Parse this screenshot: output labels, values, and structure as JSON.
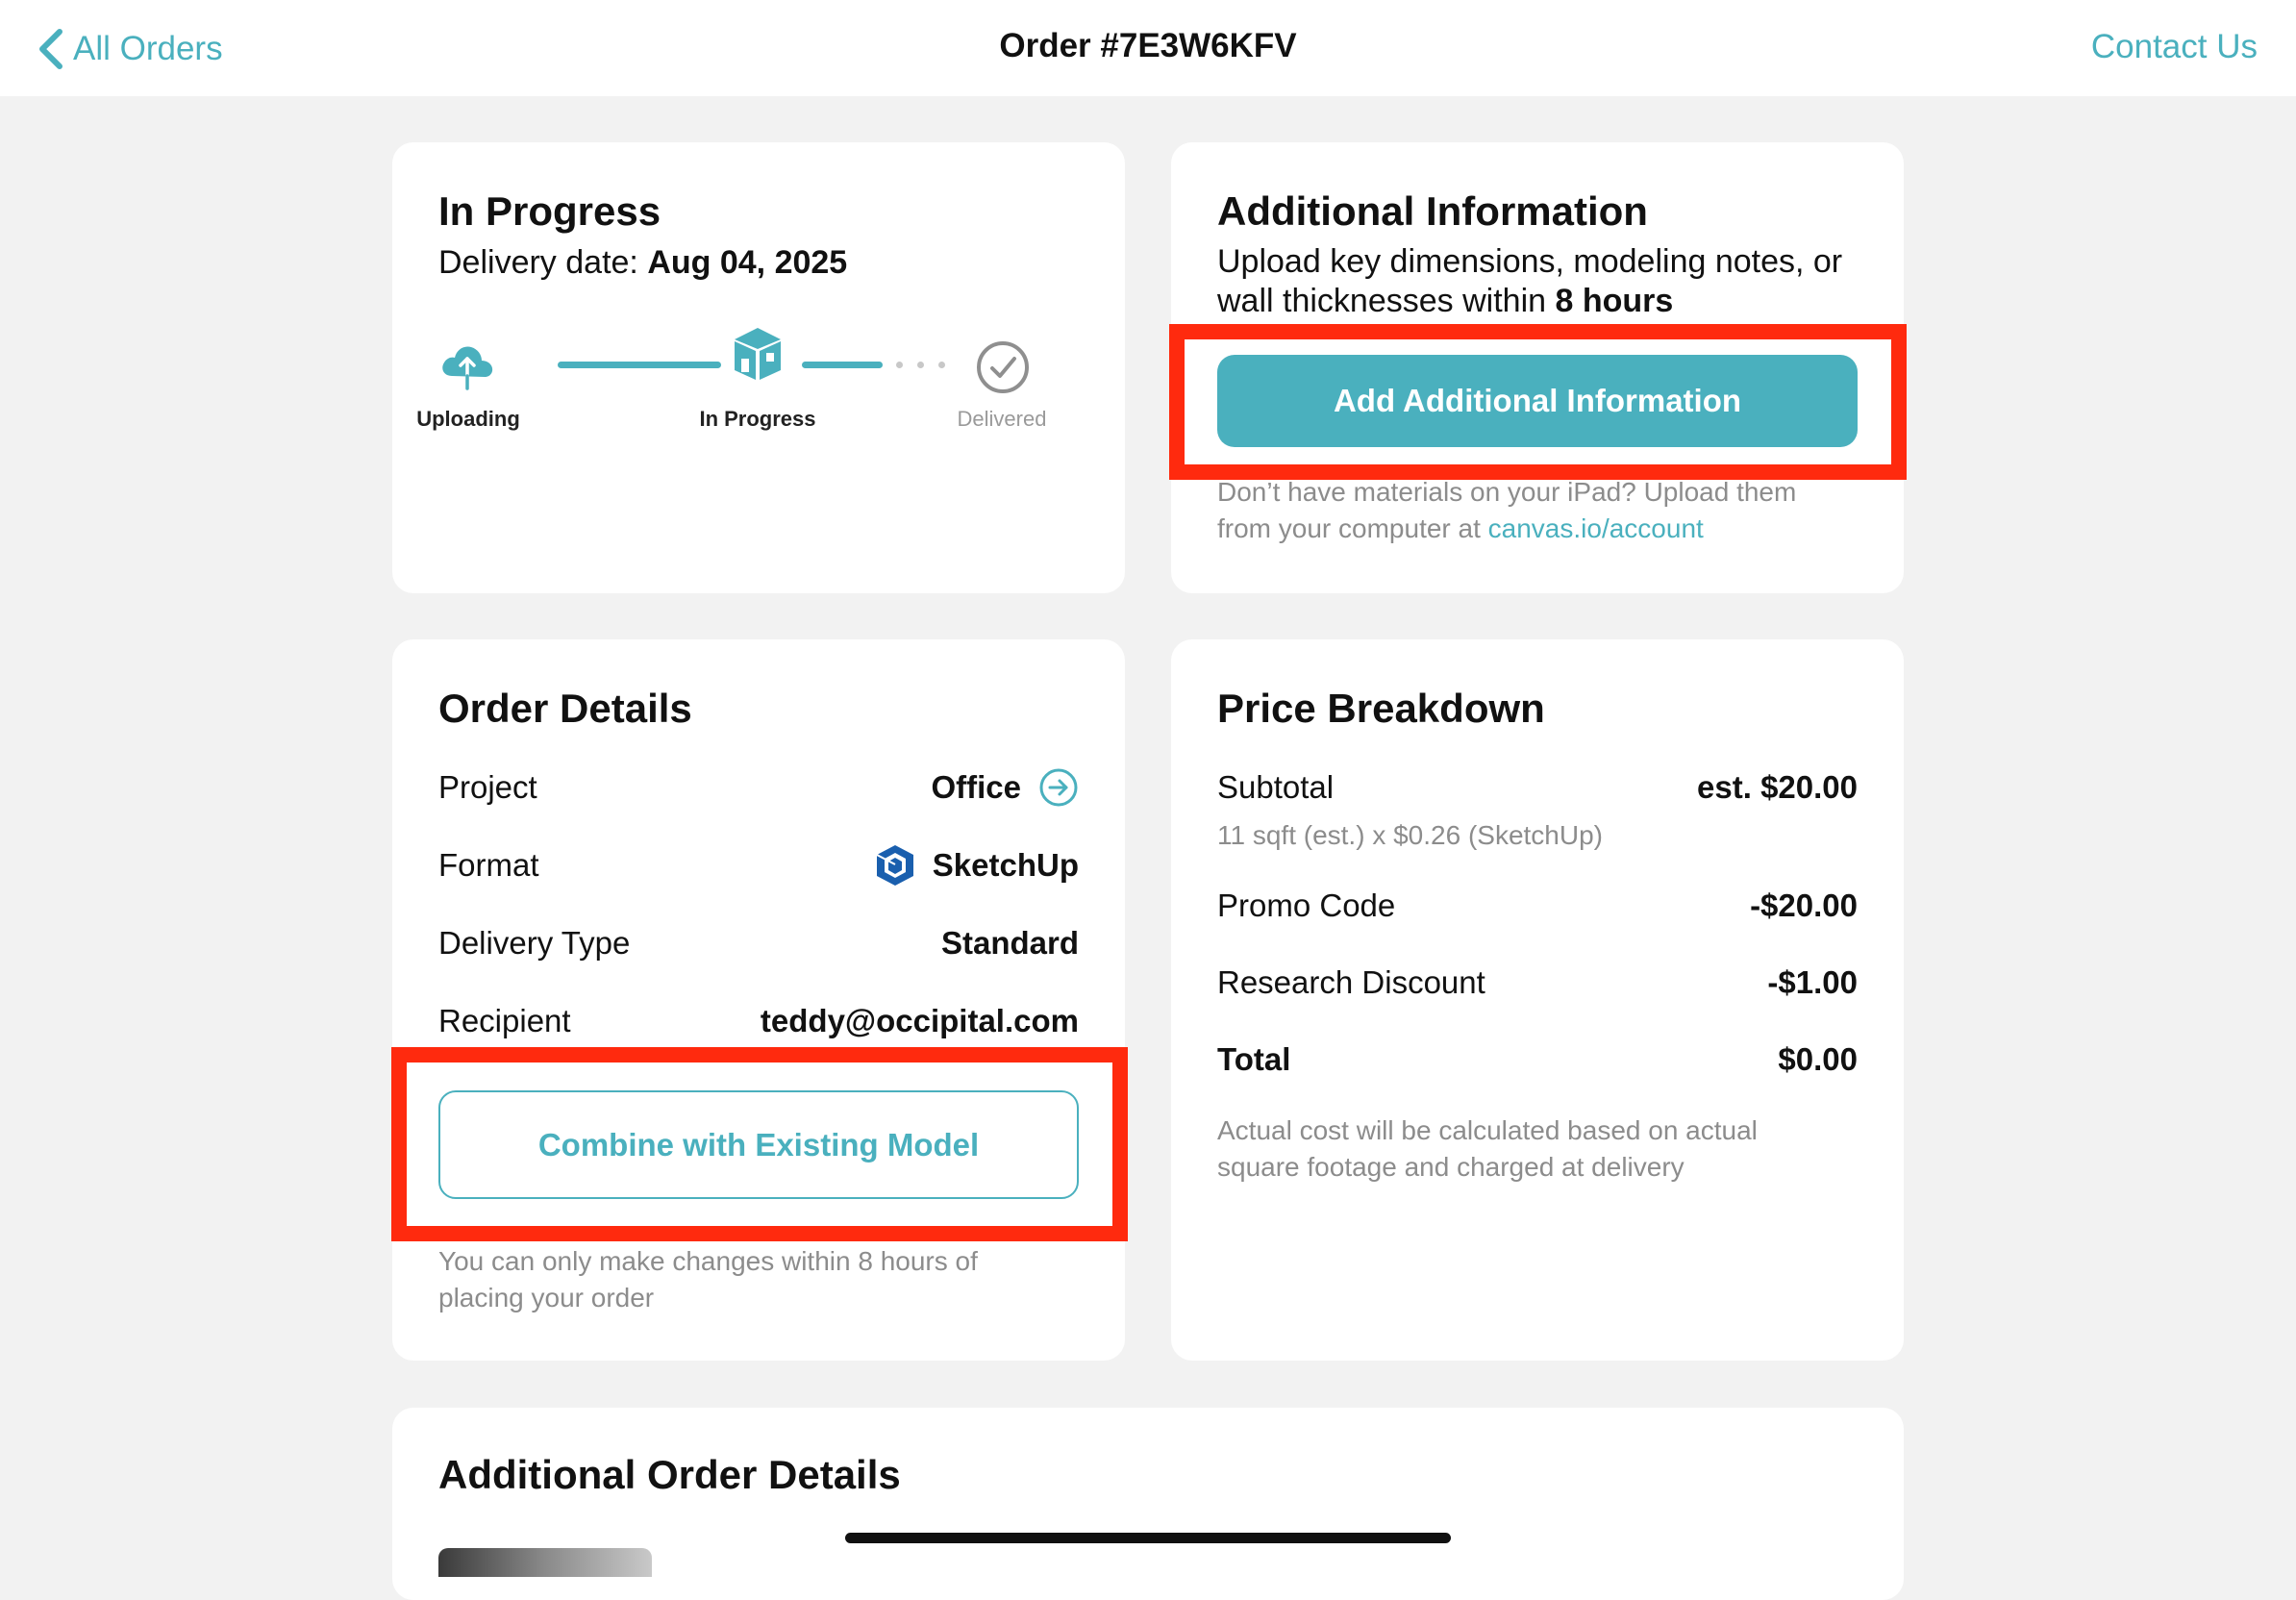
{
  "nav": {
    "back_label": "All Orders",
    "title": "Order #7E3W6KFV",
    "contact_label": "Contact Us"
  },
  "status_card": {
    "title": "In Progress",
    "delivery_prefix": "Delivery date: ",
    "delivery_date": "Aug 04, 2025",
    "steps": [
      {
        "label": "Uploading",
        "state": "done"
      },
      {
        "label": "In Progress",
        "state": "current"
      },
      {
        "label": "Delivered",
        "state": "pending"
      }
    ]
  },
  "additional_info": {
    "title": "Additional Information",
    "desc_prefix": "Upload key dimensions, modeling notes, or wall thicknesses within ",
    "desc_hours": "8 hours",
    "button_label": "Add Additional Information",
    "note_text": "Don’t have materials on your iPad? Upload them from your computer at ",
    "note_link": "canvas.io/account"
  },
  "order_details": {
    "title": "Order Details",
    "rows": [
      {
        "label": "Project",
        "value": "Office"
      },
      {
        "label": "Format",
        "value": "SketchUp"
      },
      {
        "label": "Delivery Type",
        "value": "Standard"
      },
      {
        "label": "Recipient",
        "value": "teddy@occipital.com"
      }
    ],
    "combine_button": "Combine with Existing Model",
    "note": "You can only make changes within 8 hours of placing your order"
  },
  "price": {
    "title": "Price Breakdown",
    "subtotal_label": "Subtotal",
    "subtotal_value": "est. $20.00",
    "subtotal_note": "11 sqft (est.) x $0.26 (SketchUp)",
    "promo_label": "Promo Code",
    "promo_value": "-$20.00",
    "research_label": "Research Discount",
    "research_value": "-$1.00",
    "total_label": "Total",
    "total_value": "$0.00",
    "note": "Actual cost will be calculated based on actual square footage and charged at delivery"
  },
  "extra": {
    "title": "Additional Order Details"
  },
  "colors": {
    "accent": "#4ab0be",
    "highlight": "#ff2a0e",
    "background": "#f2f2f2"
  }
}
